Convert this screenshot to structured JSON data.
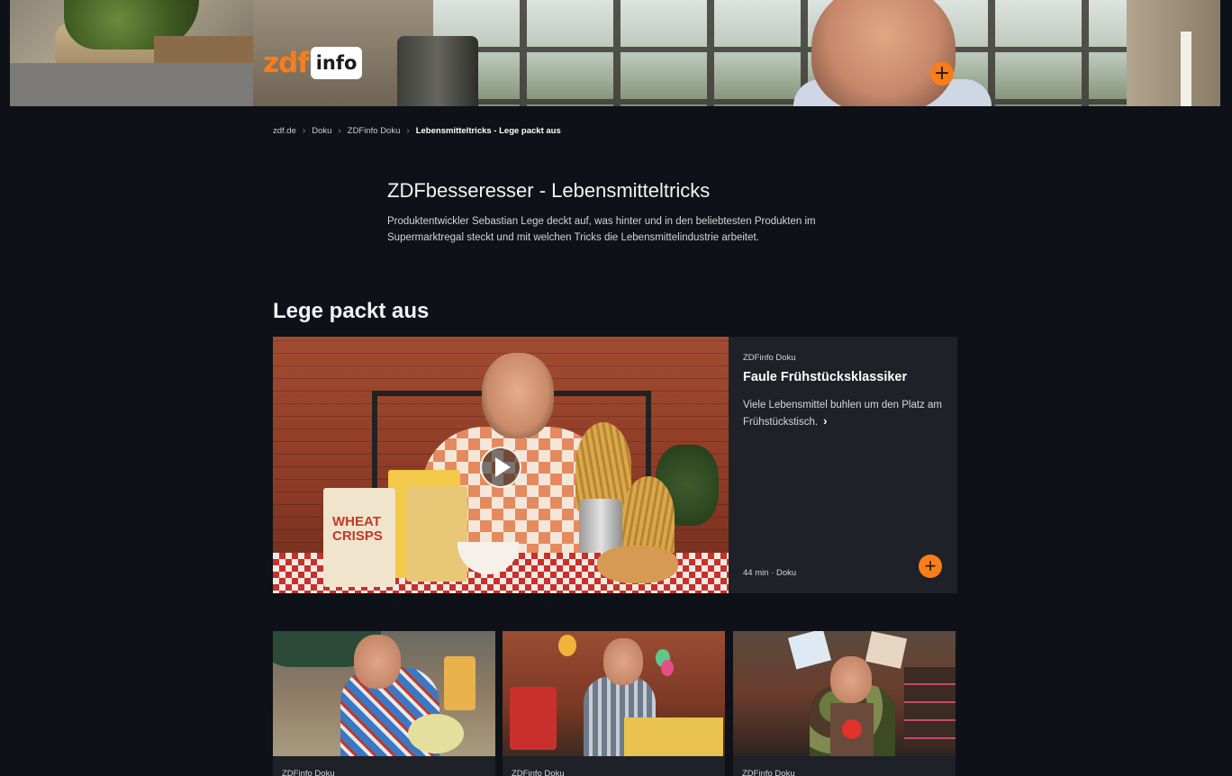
{
  "hero": {
    "logo": {
      "zdf": "zdf",
      "info": "info"
    },
    "add_label": "+"
  },
  "breadcrumb": {
    "items": [
      "zdf.de",
      "Doku",
      "ZDFinfo Doku",
      "Lebensmitteltricks - Lege packt aus"
    ],
    "separator": "›"
  },
  "intro": {
    "title": "ZDFbesseresser - Lebensmitteltricks",
    "description": "Produktentwickler Sebastian Lege deckt auf, was hinter und in den beliebtesten Produkten im Supermarktregal steckt und mit welchen Tricks die Lebensmittelindustrie arbeitet."
  },
  "section": {
    "title": "Lege packt aus"
  },
  "featured": {
    "channel": "ZDFinfo Doku",
    "title": "Faule Frühstücksklassiker",
    "description": "Viele Lebensmittel buhlen um den Platz am Frühstückstisch.",
    "chevron": "›",
    "meta": "44 min · Doku",
    "add_label": "+",
    "package_text": "WHEAT CRISPS"
  },
  "grid": [
    {
      "channel": "ZDFinfo Doku"
    },
    {
      "channel": "ZDFinfo Doku"
    },
    {
      "channel": "ZDFinfo Doku"
    }
  ],
  "colors": {
    "accent": "#fa7d19",
    "background": "#0e1117",
    "card": "#1e2128"
  },
  "icons": {
    "add": "plus-circle-icon",
    "play": "play-icon",
    "chevron": "chevron-right-icon",
    "separator": "chevron-right-icon"
  }
}
